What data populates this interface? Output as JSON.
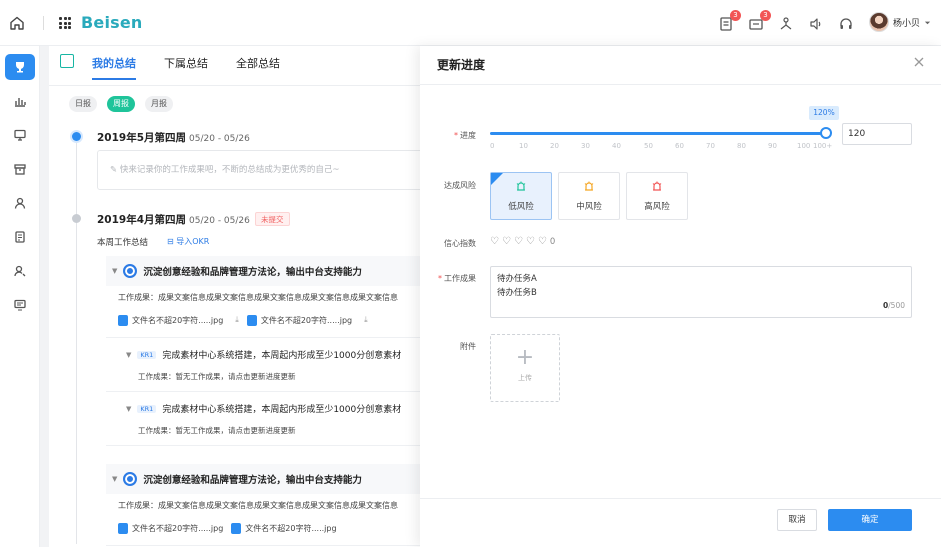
{
  "topbar": {
    "logo": "Beisen",
    "badges": [
      "3",
      "3"
    ],
    "user_name": "杨小贝"
  },
  "tabs": {
    "mine": "我的总结",
    "subordinate": "下属总结",
    "all": "全部总结"
  },
  "periods": {
    "daily": "日报",
    "weekly": "周报",
    "monthly": "月报"
  },
  "weeks": [
    {
      "title": "2019年5月第四周",
      "range": "05/20 - 05/26",
      "placeholder": "快来记录你的工作成果吧，不断的总结成为更优秀的自己~"
    },
    {
      "title": "2019年4月第四周",
      "range": "05/20 - 05/26",
      "status": "未提交"
    }
  ],
  "summary": {
    "label": "本周工作总结",
    "import_okr": "导入OKR"
  },
  "objectives": [
    {
      "title": "沉淀创意经验和品牌管理方法论，输出中台支持能力",
      "result": "工作成果：成果文案信息成果文案信息成果文案信息成果文案信息成果文案信息",
      "files": [
        "文件名不超20字符.....jpg",
        "文件名不超20字符.....jpg"
      ],
      "krs": [
        {
          "tag": "KR1",
          "title": "完成素材中心系统搭建，本周起内形成至少1000分创意素材",
          "sub": "工作成果：暂无工作成果，请点击更新进度更新"
        },
        {
          "tag": "KR1",
          "title": "完成素材中心系统搭建，本周起内形成至少1000分创意素材",
          "sub": "工作成果：暂无工作成果，请点击更新进度更新"
        }
      ]
    },
    {
      "title": "沉淀创意经验和品牌管理方法论，输出中台支持能力",
      "result": "工作成果：成果文案信息成果文案信息成果文案信息成果文案信息成果文案信息",
      "files": [
        "文件名不超20字符.....jpg",
        "文件名不超20字符.....jpg"
      ]
    }
  ],
  "panel": {
    "title": "更新进度",
    "progress_label": "进度",
    "progress_value": "120",
    "progress_tip": "120%",
    "ticks": [
      "0",
      "10",
      "20",
      "30",
      "40",
      "50",
      "60",
      "70",
      "80",
      "90",
      "100",
      "100+"
    ],
    "risk_label": "达成风险",
    "risks": [
      "低风险",
      "中风险",
      "高风险"
    ],
    "risk_colors": [
      "#1fc49a",
      "#f5a623",
      "#f25555"
    ],
    "confidence_label": "信心指数",
    "confidence_value": "0",
    "result_label": "工作成果",
    "result_lines": [
      "待办任务A",
      "待办任务B"
    ],
    "counter_used": "0",
    "counter_max": "/500",
    "attach_label": "附件",
    "upload_label": "上传",
    "cancel": "取消",
    "confirm": "确定"
  }
}
